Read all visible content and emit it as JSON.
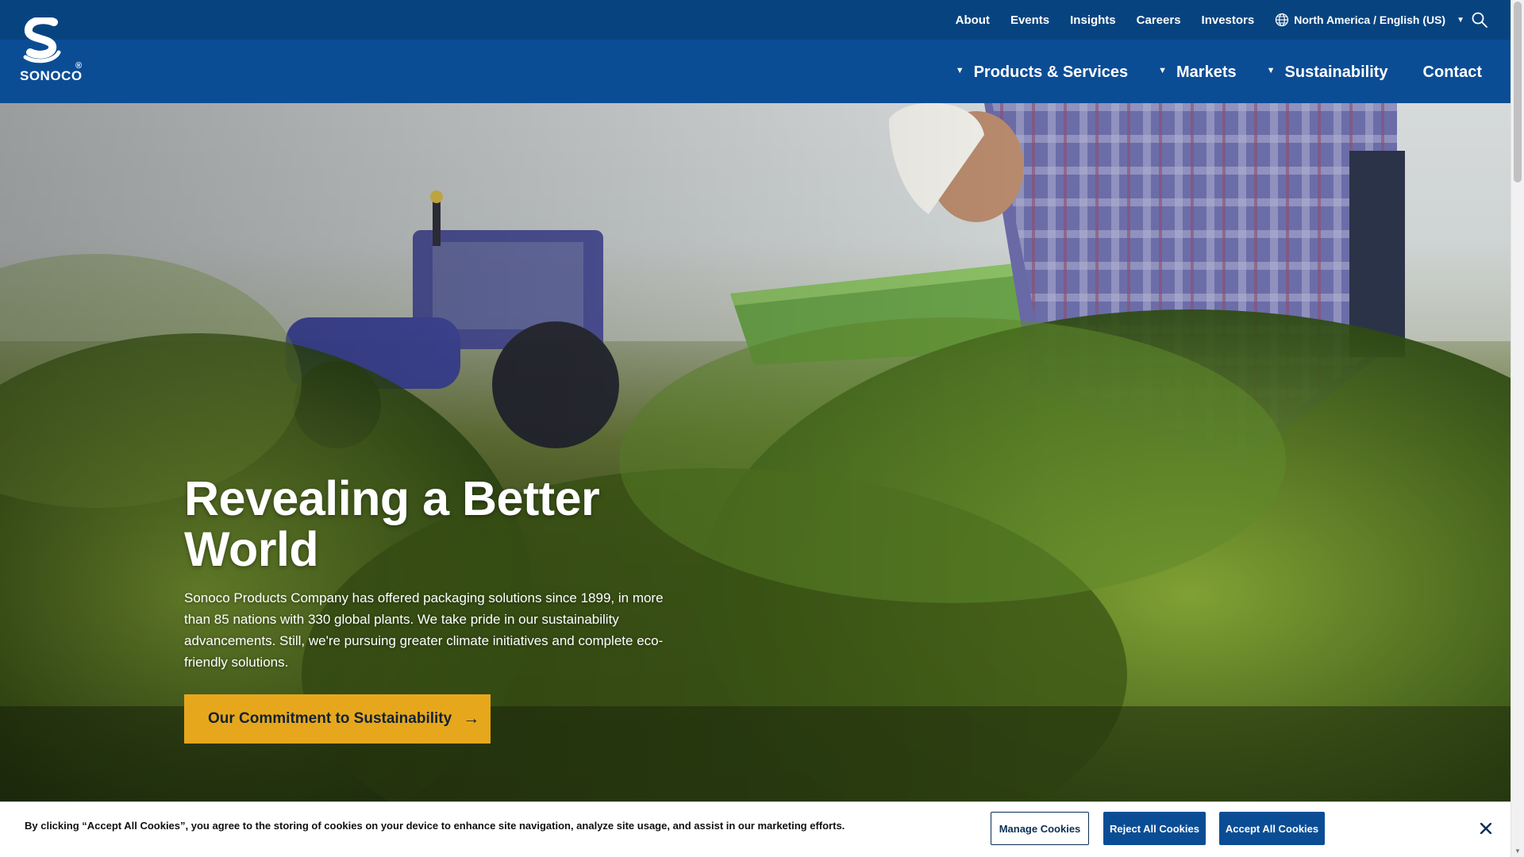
{
  "brand": {
    "logo_text": "SONOCO",
    "registered_mark": "®"
  },
  "utility_nav": {
    "links": [
      {
        "label": "About"
      },
      {
        "label": "Events"
      },
      {
        "label": "Insights"
      },
      {
        "label": "Careers"
      },
      {
        "label": "Investors"
      }
    ],
    "region_label": "North America / English (US)",
    "region_icon": "globe-icon",
    "search_icon": "search-icon"
  },
  "main_nav": {
    "items": [
      {
        "label": "Products & Services",
        "has_dropdown": true
      },
      {
        "label": "Markets",
        "has_dropdown": true
      },
      {
        "label": "Sustainability",
        "has_dropdown": true
      },
      {
        "label": "Contact",
        "has_dropdown": false
      }
    ]
  },
  "hero": {
    "title": "Revealing a Better World",
    "description": "Sonoco Products Company has offered packaging solutions since 1899, in more than 85 nations with 330 global plants. We take pride in our sustainability advancements. Still, we're pursuing greater climate initiatives and complete eco-friendly solutions.",
    "cta_label": "Our Commitment to Sustainability",
    "cta_icon": "arrow-right-icon"
  },
  "cookie_banner": {
    "text": "By clicking “Accept All Cookies”, you agree to the storing of cookies on your device to enhance site navigation, analyze site usage, and assist in our marketing efforts.",
    "manage_label": "Manage Cookies",
    "reject_label": "Reject All Cookies",
    "accept_label": "Accept All Cookies",
    "close_icon": "close-icon"
  },
  "colors": {
    "header_blue": "#0b4d95",
    "utility_blue": "#07447f",
    "cta_gold": "#e7a71d",
    "button_blue": "#0b4d95"
  }
}
